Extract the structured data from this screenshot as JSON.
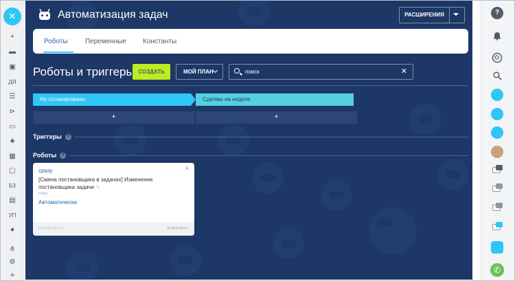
{
  "app": {
    "title": "Автоматизация задач",
    "extensions_label": "РАСШИРЕНИЯ"
  },
  "left_sidebar": {
    "close_glyph": "✕",
    "items": [
      {
        "icon": "chat-icon",
        "glyph": "▪"
      },
      {
        "icon": "layers-icon",
        "glyph": "▬"
      },
      {
        "icon": "inbox-icon",
        "glyph": "▣"
      },
      {
        "label": "ДЯ"
      },
      {
        "icon": "filter-icon",
        "glyph": "☰"
      },
      {
        "icon": "share-icon",
        "glyph": "⊳"
      },
      {
        "icon": "card-icon",
        "glyph": "▭"
      },
      {
        "icon": "people-icon",
        "glyph": "♣"
      },
      {
        "icon": "calendar-icon",
        "glyph": "▦"
      },
      {
        "icon": "screen-icon",
        "glyph": "▢"
      },
      {
        "label": "БЗ"
      },
      {
        "icon": "doc-icon",
        "glyph": "▤"
      },
      {
        "label": "УП"
      },
      {
        "icon": "check-icon",
        "glyph": "●"
      },
      {
        "icon": "sitemap-icon",
        "glyph": "⋔"
      },
      {
        "icon": "settings-icon",
        "glyph": "⚙"
      },
      {
        "icon": "plus-icon",
        "glyph": "+"
      }
    ]
  },
  "tabs": [
    {
      "label": "Роботы",
      "active": true
    },
    {
      "label": "Переменные",
      "active": false
    },
    {
      "label": "Константы",
      "active": false
    }
  ],
  "toolbar": {
    "heading": "Роботы и триггеры",
    "create_label": "СОЗДАТЬ",
    "plan_label": "МОЙ ПЛАН",
    "search_value": "поиск",
    "clear_glyph": "✕"
  },
  "stages": [
    {
      "label": "Не спланированы",
      "color": "#2fc6f6"
    },
    {
      "label": "Сделаю на неделе",
      "color": "#55d0e0"
    }
  ],
  "add_glyph": "+",
  "sections": {
    "triggers_label": "Триггеры",
    "robots_label": "Роботы",
    "help_glyph": "?"
  },
  "robot_card": {
    "when": "сразу",
    "name": "[Смена постановщика в задачах] Изменение постановщика задачи",
    "who_label": "кому:",
    "condition": "Автоматически",
    "copy_label": "копировать",
    "edit_label": "изменить",
    "close_glyph": "✕",
    "edit_glyph": "✎"
  },
  "right_sidebar": {
    "items": [
      {
        "icon": "help-icon",
        "glyph": "?"
      },
      {
        "icon": "bell-icon",
        "glyph": "🔔"
      },
      {
        "icon": "chat-search-icon",
        "glyph": "◌"
      },
      {
        "icon": "search-icon",
        "glyph": "⚲"
      },
      {
        "icon": "group-chat-icon"
      },
      {
        "icon": "user-chat-icon"
      },
      {
        "icon": "user-chat-2-icon"
      },
      {
        "icon": "calendar-chat-icon"
      },
      {
        "icon": "message-icon"
      },
      {
        "icon": "message-2-icon"
      },
      {
        "icon": "message-3-icon"
      },
      {
        "icon": "forward-icon"
      },
      {
        "icon": "document-icon"
      },
      {
        "icon": "phone-icon",
        "glyph": "✆"
      }
    ]
  },
  "colors": {
    "main_bg": "#1d3766",
    "accent_blue": "#2fc6f6",
    "create_green": "#bbed21",
    "link_blue": "#2067b0"
  }
}
